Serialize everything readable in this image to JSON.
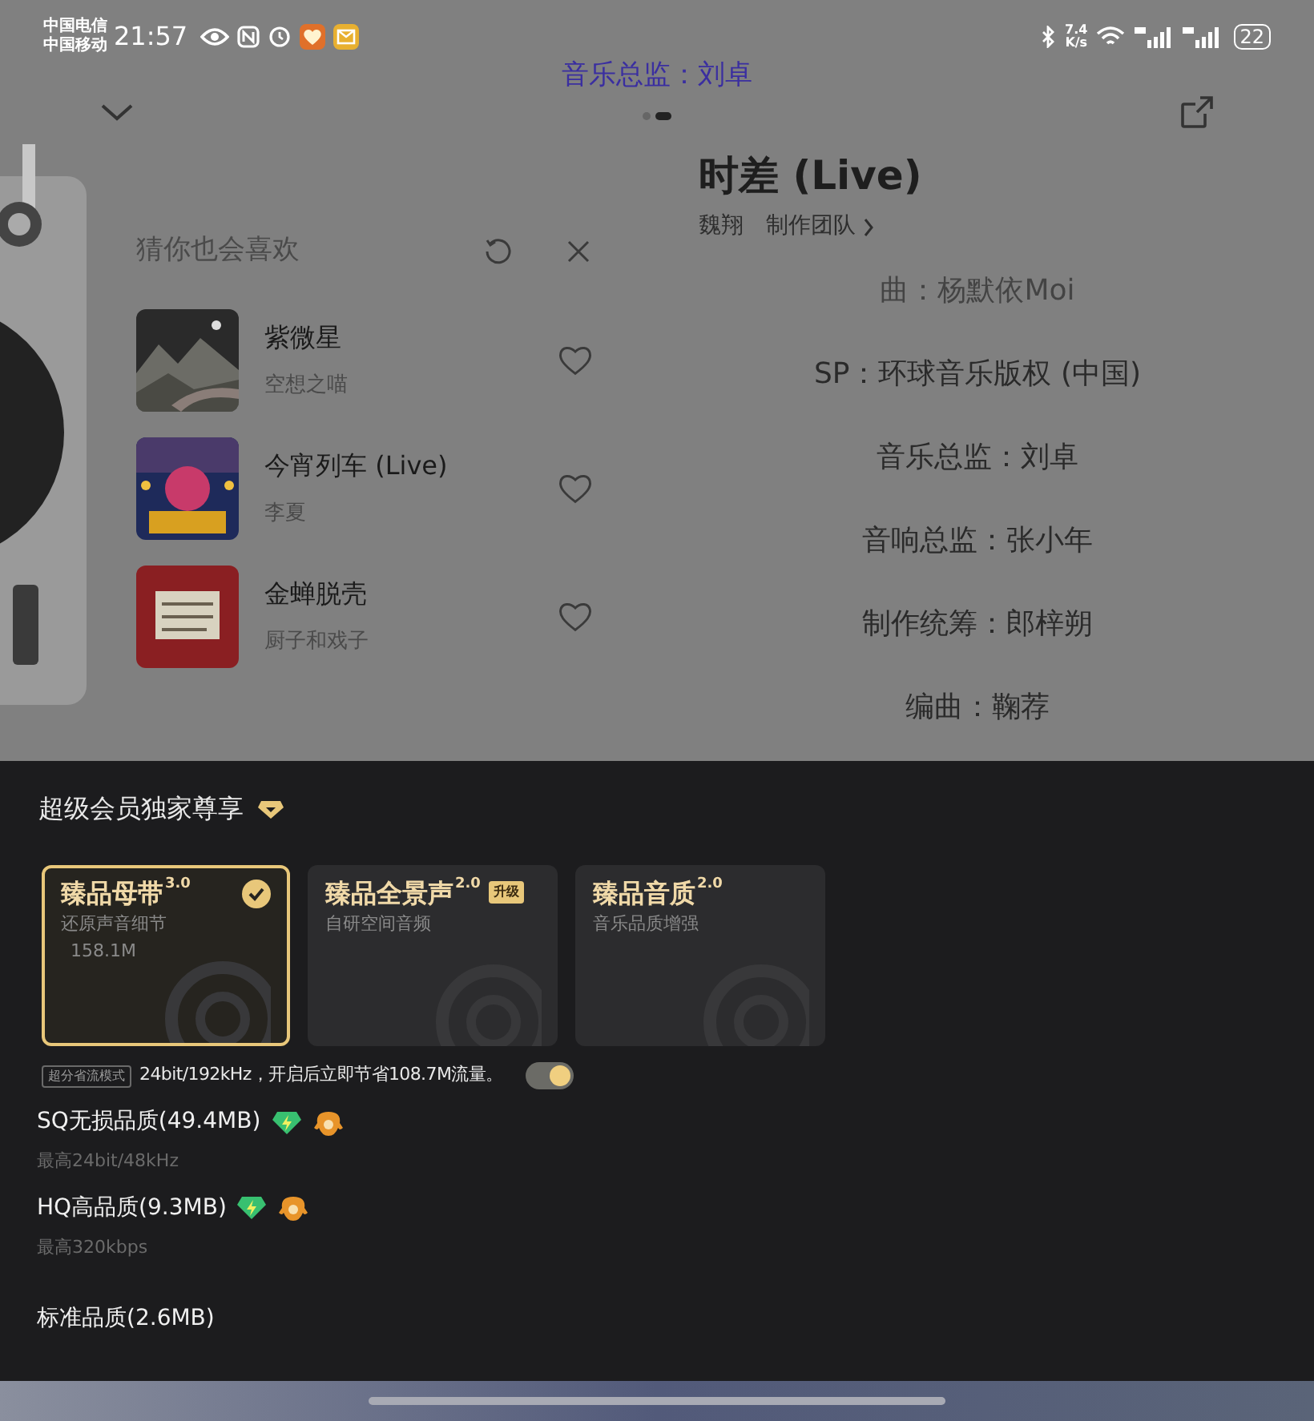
{
  "status_bar": {
    "carriers": [
      "中国电信",
      "中国移动"
    ],
    "time": "21:57",
    "net_speed": "7.4",
    "net_speed_unit": "K/s",
    "battery": "22"
  },
  "header": {
    "lyric_preview": "音乐总监：刘卓",
    "pages": [
      {
        "selected": false
      },
      {
        "selected": true
      }
    ]
  },
  "recommend": {
    "title": "猜你也会喜欢",
    "songs": [
      {
        "title": "紫微星",
        "artist": "空想之喵"
      },
      {
        "title": "今宵列车 (Live)",
        "artist": "李夏"
      },
      {
        "title": "金蝉脱壳",
        "artist": "厨子和戏子"
      }
    ]
  },
  "song": {
    "title": "时差 (Live)",
    "artist": "魏翔",
    "team_link": "制作团队"
  },
  "credits": [
    {
      "text": "曲：杨默依Moi"
    },
    {
      "text": "SP：环球音乐版权 (中国)"
    },
    {
      "text": "音乐总监：刘卓"
    },
    {
      "text": "音响总监：张小年"
    },
    {
      "text": "制作统筹：郎梓朔"
    },
    {
      "text": "编曲：鞠荐"
    }
  ],
  "sheet": {
    "title": "超级会员独家尊享",
    "cards": [
      {
        "name": "臻品母带",
        "version": "3.0",
        "subtitle": "还原声音细节",
        "size": "158.1M",
        "selected": true
      },
      {
        "name": "臻品全景声",
        "version": "2.0",
        "badge": "升级",
        "subtitle": "自研空间音频",
        "selected": false
      },
      {
        "name": "臻品音质",
        "version": "2.0",
        "subtitle": "音乐品质增强",
        "selected": false
      }
    ],
    "saver": {
      "tag": "超分省流模式",
      "text": "24bit/192kHz，开启后立即节省108.7M流量。",
      "on": true
    },
    "qualities": [
      {
        "title": "SQ无损品质(49.4MB)",
        "detail": "最高24bit/48kHz",
        "vip": true
      },
      {
        "title": "HQ高品质(9.3MB)",
        "detail": "最高320kbps",
        "vip": true
      },
      {
        "title": "标准品质(2.6MB)",
        "vip": false
      }
    ]
  }
}
